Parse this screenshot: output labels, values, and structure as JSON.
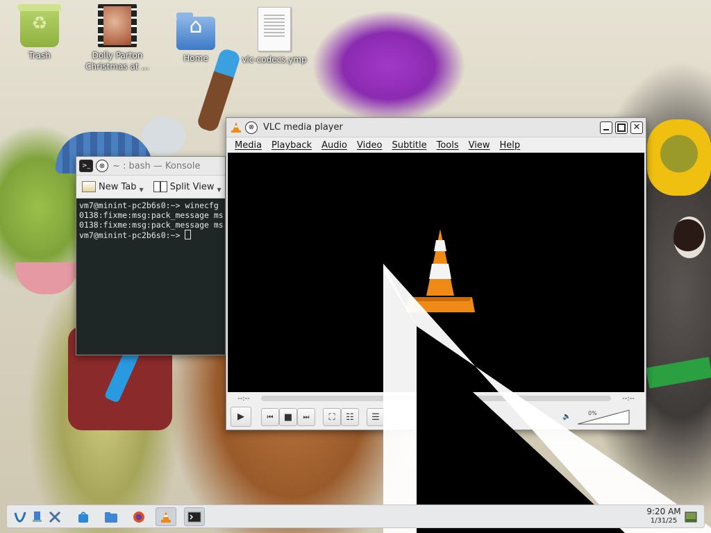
{
  "desktop": {
    "icons": [
      {
        "label": "Trash"
      },
      {
        "label": "Dolly Parton\nChristmas at ..."
      },
      {
        "label": "Home"
      },
      {
        "label": "vlc-codecs.ymp"
      }
    ]
  },
  "konsole": {
    "title": "~ : bash — Konsole",
    "toolbar": {
      "new_tab": "New Tab",
      "split_view": "Split View"
    },
    "lines": [
      "vm7@minint-pc2b6s0:~> winecfg",
      "0138:fixme:msg:pack_message ms",
      "0138:fixme:msg:pack_message ms",
      "vm7@minint-pc2b6s0:~> "
    ]
  },
  "vlc": {
    "title": "VLC media player",
    "menu": [
      "Media",
      "Playback",
      "Audio",
      "Video",
      "Subtitle",
      "Tools",
      "View",
      "Help"
    ],
    "time_elapsed": "--:--",
    "time_total": "--:--",
    "volume_label": "0%",
    "volume": 0,
    "position": 0
  },
  "taskbar": {
    "time": "9:20 AM",
    "date": "1/31/25"
  },
  "colors": {
    "vlc_orange": "#f08a16",
    "terminal_bg": "#1f2626",
    "taskbar_bg": "#e8e9ea"
  }
}
